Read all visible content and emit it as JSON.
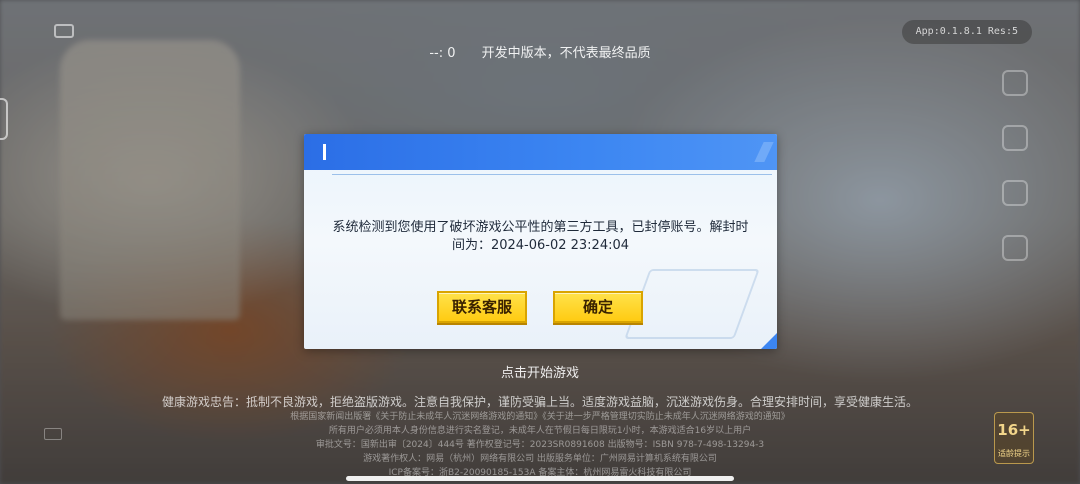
{
  "hud": {
    "fps_text": "--: 0",
    "dev_notice": "开发中版本，不代表最终品质",
    "version": "App:0.1.8.1 Res:5"
  },
  "dialog": {
    "message": "系统检测到您使用了破坏游戏公平性的第三方工具，已封停账号。解封时间为：2024-06-02 23:24:04",
    "buttons": {
      "contact": "联系客服",
      "confirm": "确定"
    }
  },
  "footer": {
    "start_game": "点击开始游戏",
    "health_notice": "健康游戏忠告：抵制不良游戏，拒绝盗版游戏。注意自我保护，谨防受骗上当。适度游戏益脑，沉迷游戏伤身。合理安排时间，享受健康生活。",
    "legal_lines": [
      "根据国家新闻出版署《关于防止未成年人沉迷网络游戏的通知》《关于进一步严格管理切实防止未成年人沉迷网络游戏的通知》",
      "所有用户必须用本人身份信息进行实名登记，未成年人在节假日每日限玩1小时，本游戏适合16岁以上用户",
      "审批文号：国新出审〔2024〕444号  著作权登记号：2023SR0891608  出版物号：ISBN 978-7-498-13294-3",
      "游戏著作权人：网易（杭州）网络有限公司  出版服务单位：广州网易计算机系统有限公司",
      "ICP备案号：浙B2-20090185-153A  备案主体：杭州网易雷火科技有限公司"
    ],
    "age_rating": "16+",
    "age_label": "适龄提示"
  }
}
